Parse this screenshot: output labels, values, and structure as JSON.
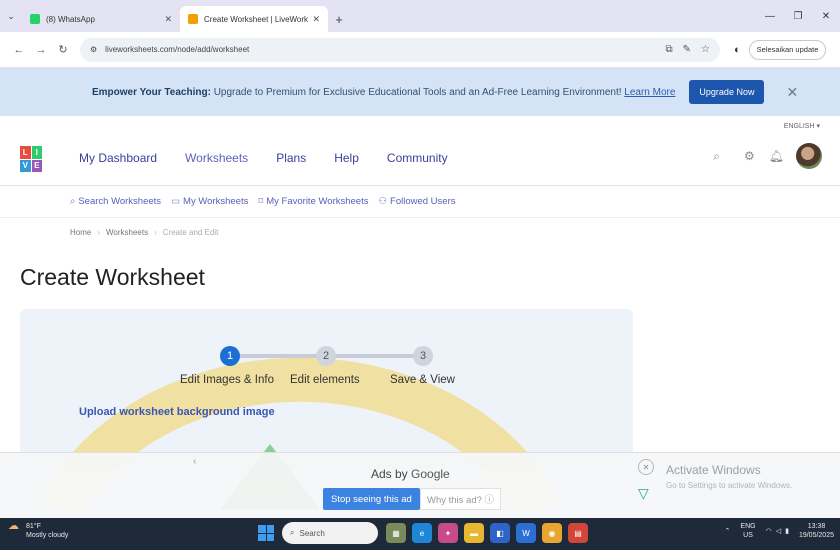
{
  "browser": {
    "tabs": [
      {
        "title": "(8) WhatsApp",
        "color": "#25d366",
        "active": false
      },
      {
        "title": "Create Worksheet | LiveWorksh...",
        "color": "#f29f05",
        "active": true
      }
    ],
    "new_tab_label": "+",
    "url": "liveworksheets.com/node/add/worksheet",
    "update_label": "Selesaikan update"
  },
  "banner": {
    "headline": "Empower Your Teaching:",
    "text": "Upgrade to Premium for Exclusive Educational Tools and an Ad-Free Learning Environment!",
    "link": "Learn More",
    "button": "Upgrade Now",
    "close": "✕"
  },
  "site": {
    "language": "ENGLISH ▾",
    "logo_letters": [
      "L",
      "I",
      "V",
      "E"
    ],
    "logo_colors": [
      "#e74c3c",
      "#2ecc71",
      "#3498db",
      "#9b59b6"
    ],
    "nav": [
      "My Dashboard",
      "Worksheets",
      "Plans",
      "Help",
      "Community"
    ],
    "subnav": [
      {
        "icon": "search-icon",
        "label": "Search Worksheets"
      },
      {
        "icon": "book-icon",
        "label": "My Worksheets"
      },
      {
        "icon": "bookmark-icon",
        "label": "My Favorite Worksheets"
      },
      {
        "icon": "users-icon",
        "label": "Followed Users"
      }
    ],
    "breadcrumbs": [
      "Home",
      "Worksheets",
      "Create and Edit"
    ]
  },
  "page": {
    "title": "Create Worksheet",
    "steps": [
      {
        "number": "1",
        "label": "Edit Images & Info",
        "active": true
      },
      {
        "number": "2",
        "label": "Edit elements",
        "active": false
      },
      {
        "number": "3",
        "label": "Save & View",
        "active": false
      }
    ],
    "upload_link": "Upload worksheet background image"
  },
  "ad": {
    "ads_by": "Ads by",
    "google": "Google",
    "stop_button": "Stop seeing this ad",
    "why_button": "Why this ad? ⓘ"
  },
  "activate_windows": {
    "title": "Activate Windows",
    "subtitle": "Go to Settings to activate Windows."
  },
  "taskbar": {
    "weather_temp": "81°F",
    "weather_desc": "Mostly cloudy",
    "search_label": "Search",
    "lang_top": "ENG",
    "lang_bottom": "US",
    "time": "13:38",
    "date": "19/05/2025"
  }
}
